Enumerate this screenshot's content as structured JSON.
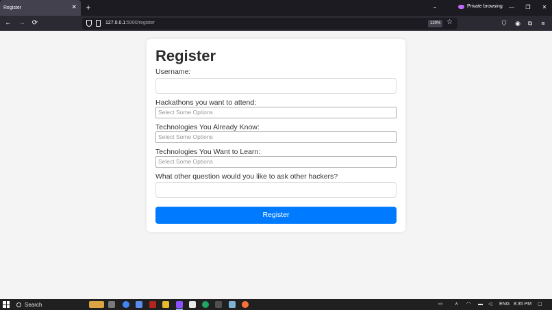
{
  "browser": {
    "tab_title": "Register",
    "tab_close": "✕",
    "new_tab": "+",
    "tab_list": "⌄",
    "private_label": "Private browsing",
    "url_host": "127.0.0.1",
    "url_path": ":5000/register",
    "zoom": "120%",
    "colors": {
      "tabbar": "#1c1b22",
      "toolbar": "#2b2a33",
      "tab": "#42414d",
      "private_accent": "#c069ff"
    }
  },
  "form": {
    "title": "Register",
    "username_label": "Username:",
    "username_value": "",
    "hackathons_label": "Hackathons you want to attend:",
    "hackathons_placeholder": "Select Some Options",
    "known_label": "Technologies You Already Know:",
    "known_placeholder": "Select Some Options",
    "learn_label": "Technologies You Want to Learn:",
    "learn_placeholder": "Select Some Options",
    "question_label": "What other question would you like to ask other hackers?",
    "question_value": "",
    "submit_label": "Register",
    "accent": "#007bff"
  },
  "taskbar": {
    "search_label": "Search",
    "language": "ENG",
    "time": "8:35 PM"
  }
}
